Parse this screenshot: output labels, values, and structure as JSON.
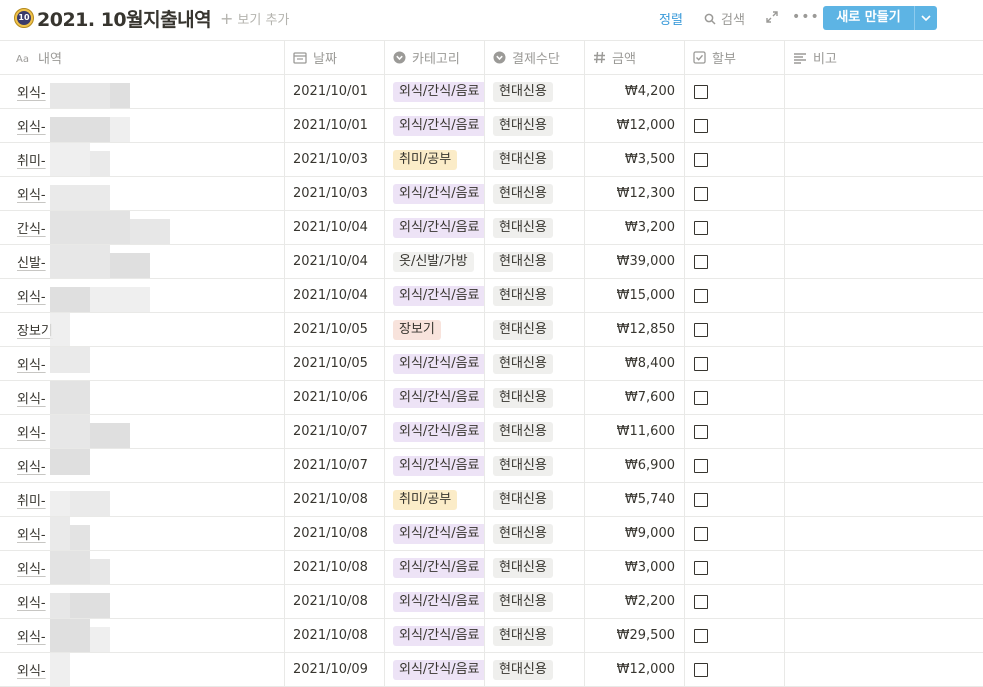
{
  "header": {
    "badge_text": "10",
    "title": "2021. 10월지출내역",
    "add_view_label": "보기 추가",
    "sort_label": "정렬",
    "search_label": "검색",
    "more_label": "•••",
    "new_button_label": "새로 만들기"
  },
  "columns": [
    "내역",
    "날짜",
    "카테고리",
    "결제수단",
    "금액",
    "할부",
    "비고"
  ],
  "rows": [
    {
      "name": "외식-",
      "date": "2021/10/01",
      "category": "외식/간식/음료",
      "cat_type": "eat",
      "payment": "현대신용",
      "amount": "₩4,200"
    },
    {
      "name": "외식-",
      "date": "2021/10/01",
      "category": "외식/간식/음료",
      "cat_type": "eat",
      "payment": "현대신용",
      "amount": "₩12,000"
    },
    {
      "name": "취미-",
      "date": "2021/10/03",
      "category": "취미/공부",
      "cat_type": "hobby",
      "payment": "현대신용",
      "amount": "₩3,500"
    },
    {
      "name": "외식-",
      "date": "2021/10/03",
      "category": "외식/간식/음료",
      "cat_type": "eat",
      "payment": "현대신용",
      "amount": "₩12,300"
    },
    {
      "name": "간식-",
      "date": "2021/10/04",
      "category": "외식/간식/음료",
      "cat_type": "eat",
      "payment": "현대신용",
      "amount": "₩3,200"
    },
    {
      "name": "신발-",
      "date": "2021/10/04",
      "category": "옷/신발/가방",
      "cat_type": "clothes",
      "payment": "현대신용",
      "amount": "₩39,000"
    },
    {
      "name": "외식-",
      "date": "2021/10/04",
      "category": "외식/간식/음료",
      "cat_type": "eat",
      "payment": "현대신용",
      "amount": "₩15,000"
    },
    {
      "name": "장보기",
      "date": "2021/10/05",
      "category": "장보기",
      "cat_type": "grocery",
      "payment": "현대신용",
      "amount": "₩12,850"
    },
    {
      "name": "외식-",
      "date": "2021/10/05",
      "category": "외식/간식/음료",
      "cat_type": "eat",
      "payment": "현대신용",
      "amount": "₩8,400"
    },
    {
      "name": "외식-",
      "date": "2021/10/06",
      "category": "외식/간식/음료",
      "cat_type": "eat",
      "payment": "현대신용",
      "amount": "₩7,600"
    },
    {
      "name": "외식-",
      "date": "2021/10/07",
      "category": "외식/간식/음료",
      "cat_type": "eat",
      "payment": "현대신용",
      "amount": "₩11,600"
    },
    {
      "name": "외식-",
      "date": "2021/10/07",
      "category": "외식/간식/음료",
      "cat_type": "eat",
      "payment": "현대신용",
      "amount": "₩6,900"
    },
    {
      "name": "취미-",
      "date": "2021/10/08",
      "category": "취미/공부",
      "cat_type": "hobby",
      "payment": "현대신용",
      "amount": "₩5,740"
    },
    {
      "name": "외식-",
      "date": "2021/10/08",
      "category": "외식/간식/음료",
      "cat_type": "eat",
      "payment": "현대신용",
      "amount": "₩9,000"
    },
    {
      "name": "외식-",
      "date": "2021/10/08",
      "category": "외식/간식/음료",
      "cat_type": "eat",
      "payment": "현대신용",
      "amount": "₩3,000"
    },
    {
      "name": "외식-",
      "date": "2021/10/08",
      "category": "외식/간식/음료",
      "cat_type": "eat",
      "payment": "현대신용",
      "amount": "₩2,200"
    },
    {
      "name": "외식-",
      "date": "2021/10/08",
      "category": "외식/간식/음료",
      "cat_type": "eat",
      "payment": "현대신용",
      "amount": "₩29,500"
    },
    {
      "name": "외식-",
      "date": "2021/10/09",
      "category": "외식/간식/음료",
      "cat_type": "eat",
      "payment": "현대신용",
      "amount": "₩12,000"
    }
  ],
  "installment_checked": [
    false,
    false,
    false,
    false,
    false,
    false,
    false,
    false,
    false,
    false,
    false,
    false,
    false,
    false,
    false,
    false,
    false,
    false
  ],
  "colors": {
    "accent_blue": "#5db4e4",
    "sort_link": "#3a9ad9",
    "tag_eat": "#ede3f6",
    "tag_hobby": "#fbecc8",
    "tag_clothes": "#f1f1ef",
    "tag_grocery": "#f8e3dc",
    "tag_payment": "#efefed"
  }
}
